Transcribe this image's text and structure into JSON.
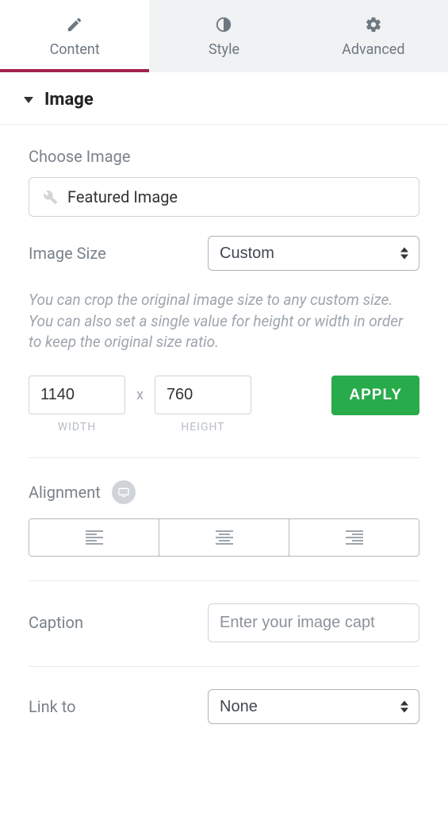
{
  "tabs": {
    "content": "Content",
    "style": "Style",
    "advanced": "Advanced"
  },
  "section": {
    "title": "Image"
  },
  "choose": {
    "label": "Choose Image",
    "value": "Featured Image"
  },
  "size": {
    "label": "Image Size",
    "value": "Custom"
  },
  "hint": "You can crop the original image size to any custom size. You can also set a single value for height or width in order to keep the original size ratio.",
  "dims": {
    "width": "1140",
    "height": "760",
    "width_label": "WIDTH",
    "height_label": "HEIGHT",
    "x": "x",
    "apply": "APPLY"
  },
  "alignment": {
    "label": "Alignment"
  },
  "caption": {
    "label": "Caption",
    "placeholder": "Enter your image capt"
  },
  "linkto": {
    "label": "Link to",
    "value": "None"
  }
}
